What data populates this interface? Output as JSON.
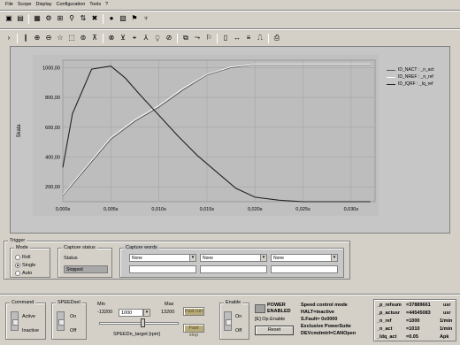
{
  "menu": [
    "File",
    "Scope",
    "Display",
    "Configuration",
    "Tools",
    "?"
  ],
  "toolbar1": [
    "save-icon",
    "print-icon",
    "layout-icon",
    "settings-icon",
    "channels-icon",
    "filter-icon",
    "sort-icon",
    "delete-icon",
    "trigger-icon",
    "clipboard-icon",
    "flag-icon",
    "antenna-icon"
  ],
  "toolbar2": [
    "chevron-right-icon",
    "pause-icon",
    "zoom-in-icon",
    "zoom-out-icon",
    "star-icon",
    "zoom-box-icon",
    "fit-vertical-icon",
    "fit-horizontal-icon",
    "fit-all-icon",
    "cursor-icon",
    "measure-icon",
    "compare-icon",
    "export-icon",
    "copy-icon",
    "page-icon",
    "step-icon",
    "marker-icon",
    "wave-icon",
    "printer-icon"
  ],
  "scope": {
    "ylabel": "Skala",
    "legend": [
      {
        "label": "ID_NACT : _n_act",
        "color": "#555555"
      },
      {
        "label": "ID_NREF : _n_ref",
        "color": "#ffffff"
      },
      {
        "label": "ID_IQRF : _Iq_ref",
        "color": "#222222"
      }
    ]
  },
  "chart_data": {
    "type": "line",
    "ylabel": "Skala",
    "xlabel": "",
    "xlim": [
      0,
      0.0325
    ],
    "ylim": [
      100,
      1050
    ],
    "x_ticks": [
      "0,000s",
      "0,005s",
      "0,010s",
      "0,015s",
      "0,020s",
      "0,025s",
      "0,030s"
    ],
    "y_ticks": [
      "1000,00",
      "800,00",
      "600,00",
      "400,00",
      "200,00"
    ],
    "y_tick_values": [
      1000,
      800,
      600,
      400,
      200
    ],
    "grid": true,
    "legend_position": "right",
    "series": [
      {
        "name": "ID_NACT : _n_act",
        "color": "#555555",
        "x": [
          0,
          0.0025,
          0.005,
          0.0075,
          0.01,
          0.0125,
          0.015,
          0.0175,
          0.02,
          0.025,
          0.03,
          0.032
        ],
        "y": [
          140,
          330,
          520,
          640,
          735,
          850,
          950,
          1000,
          1020,
          1020,
          1020,
          1020
        ]
      },
      {
        "name": "ID_NREF : _n_ref",
        "color": "#ffffff",
        "x": [
          0,
          0.0025,
          0.005,
          0.0075,
          0.01,
          0.0125,
          0.015,
          0.0175,
          0.02,
          0.025,
          0.03,
          0.032
        ],
        "y": [
          145,
          340,
          530,
          650,
          745,
          860,
          955,
          1005,
          1022,
          1022,
          1022,
          1022
        ]
      },
      {
        "name": "ID_IQRF : _Iq_ref",
        "color": "#222222",
        "x": [
          0,
          0.001,
          0.003,
          0.005,
          0.0065,
          0.008,
          0.01,
          0.012,
          0.014,
          0.016,
          0.018,
          0.02,
          0.0225,
          0.025,
          0.032
        ],
        "y": [
          330,
          690,
          990,
          1010,
          930,
          820,
          680,
          540,
          410,
          300,
          190,
          130,
          110,
          100,
          100
        ]
      }
    ]
  },
  "trigger": {
    "title": "Trigger",
    "mode_title": "Mode",
    "modes": [
      "Roll",
      "Single",
      "Auto"
    ],
    "selected_mode": "Single",
    "capture_status_title": "Capture status",
    "status_label": "Status",
    "status_value": "Stopped",
    "capture_words_title": "Capture words",
    "capture_words": [
      "None",
      "None",
      "None"
    ]
  },
  "controls": {
    "command_title": "Command",
    "active_label": "Active",
    "inactive_label": "Inactive",
    "speedsel_title": "SPEEDsel",
    "on_label": "On",
    "off_label": "Off",
    "min_label": "Min",
    "max_label": "Max",
    "min_value": "-13200",
    "max_value": "13200",
    "speed_value": "1000",
    "slider_caption": "SPEEDn_target [rpm]",
    "slider_fraction": 0.54,
    "fast_run_label": "Fast run",
    "fast_stop_label": "Fast stop",
    "enable_title": "Enable",
    "enable_on": "On",
    "enable_off": "Off",
    "power_line1": "POWER",
    "power_line2": "ENABLED",
    "op_enable": "[E] Op.Enable",
    "reset_label": "Reset",
    "status_lines": [
      "Speed control mode",
      "HALT=inactive",
      "S.Fault= 0x0000",
      "Exclusive PowerSuite",
      "DEVcmdmtrl=CANOpen"
    ],
    "params": [
      {
        "name": "_p_refsum",
        "value": "=37889661",
        "unit": "usr"
      },
      {
        "name": "_p_actusr",
        "value": "=44545083",
        "unit": "usr"
      },
      {
        "name": "_n_ref",
        "value": "=1000",
        "unit": "1/min"
      },
      {
        "name": "_n_act",
        "value": "=1010",
        "unit": "1/min"
      },
      {
        "name": "_Idq_act",
        "value": "=0.05",
        "unit": "Apk"
      }
    ]
  }
}
